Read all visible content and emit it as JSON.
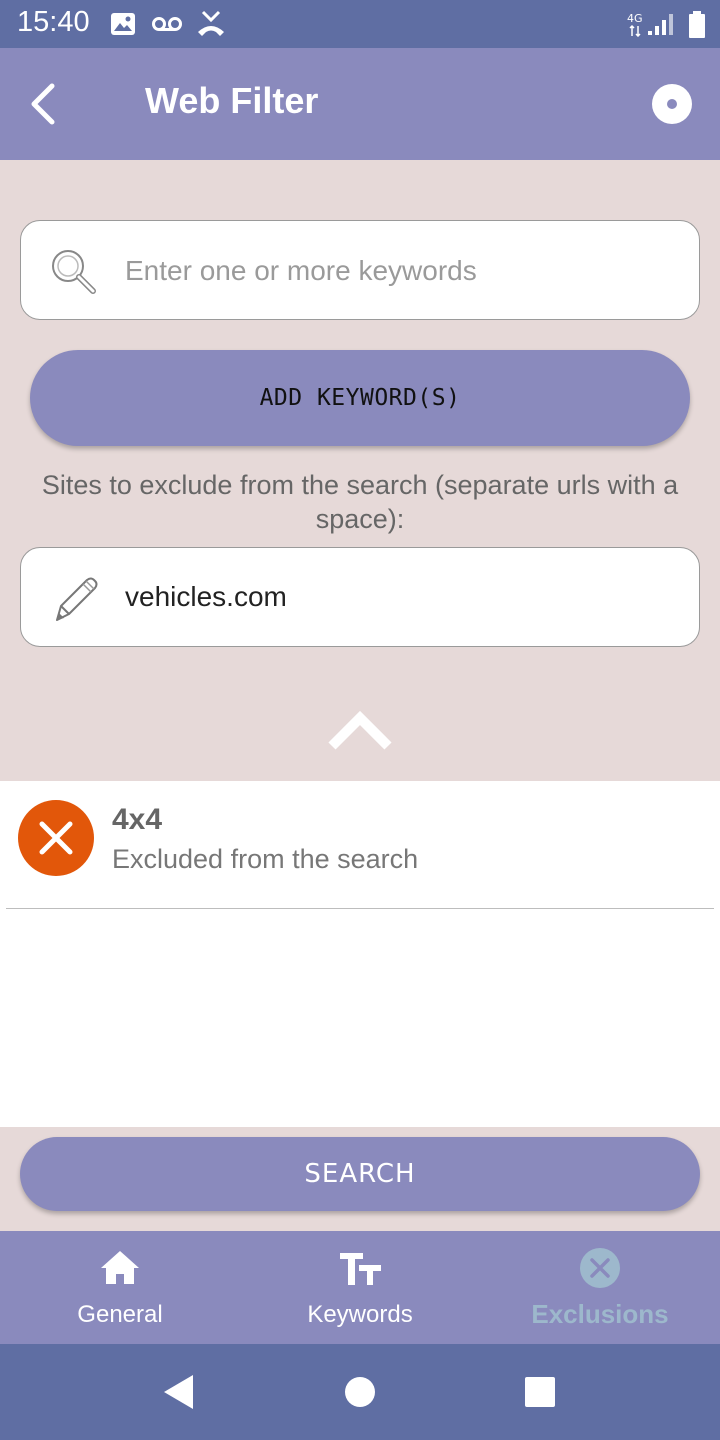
{
  "status_bar": {
    "time": "15:40",
    "network": "4G",
    "icons": [
      "image-icon",
      "voicemail-icon",
      "missed-call-icon",
      "network-4g-icon",
      "signal-icon",
      "battery-icon"
    ]
  },
  "app_bar": {
    "title": "Web Filter",
    "back_icon": "chevron-left-icon",
    "action_icon": "record-icon"
  },
  "keyword_input": {
    "placeholder": "Enter one or more keywords",
    "value": "",
    "icon": "search-icon"
  },
  "add_keywords_button": {
    "label": "ADD KEYWORD(S)"
  },
  "sites": {
    "label": "Sites to exclude from the search (separate urls with a space):",
    "value": "vehicles.com",
    "icon": "pencil-icon"
  },
  "collapse_icon": "chevron-up-icon",
  "exclusions": [
    {
      "title": "4x4",
      "subtitle": "Excluded from the search",
      "icon": "remove-icon"
    }
  ],
  "search_button": {
    "label": "SEARCH"
  },
  "bottom_nav": {
    "items": [
      {
        "label": "General",
        "icon": "home-icon",
        "active": false
      },
      {
        "label": "Keywords",
        "icon": "text-size-icon",
        "active": false
      },
      {
        "label": "Exclusions",
        "icon": "close-circle-icon",
        "active": true
      }
    ]
  },
  "colors": {
    "status_bar": "#5f6ea3",
    "primary": "#8a8abd",
    "background": "#e6d9d8",
    "exclusion_badge": "#e2570a",
    "active_tab": "#9db8cc"
  }
}
